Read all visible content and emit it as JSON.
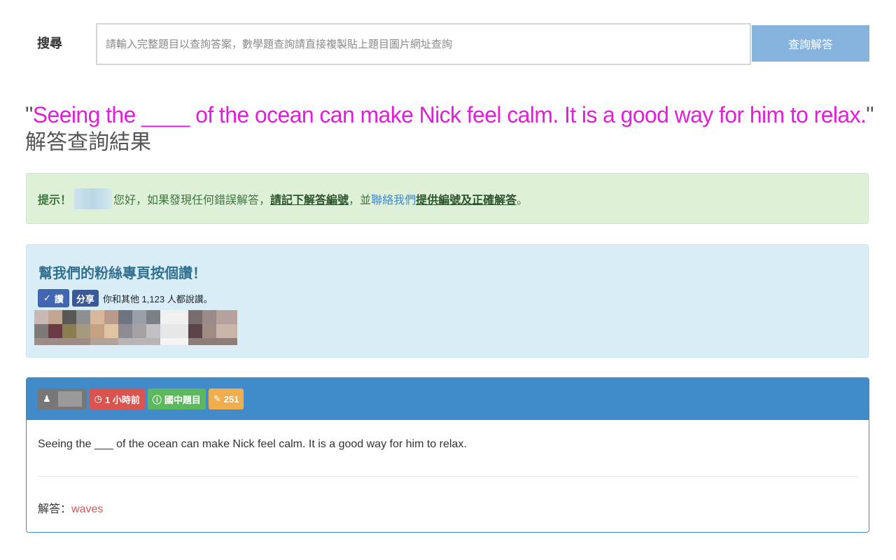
{
  "search": {
    "label": "搜尋",
    "placeholder": "請輸入完整題目以查詢答案，數學題查詢請直接複製貼上題目圖片網址查詢",
    "button_label": "查詢解答"
  },
  "title": {
    "open_quote": "\"",
    "question": "Seeing the ____ of the ocean can make Nick feel calm. It is a good way for him to relax.",
    "close_quote": "\"",
    "subtitle": "解答查詢結果"
  },
  "alert_success": {
    "prefix": "提示！",
    "text1": "您好，如果發現任何錯誤解答，",
    "bold_link1": "請記下解答編號",
    "text2": "，並",
    "link_contact": "聯絡我們",
    "bold_link2": "提供編號及正確解答",
    "text3": "。"
  },
  "alert_info": {
    "title": "幫我們的粉絲專頁按個讚！",
    "like_label": "讚",
    "share_label": "分享",
    "like_count_text": "你和其他 1,123 人都說讚。"
  },
  "question_panel": {
    "badges": {
      "time": "1 小時前",
      "category": "國中題目",
      "count": "251"
    },
    "question_text": "Seeing the ___ of the ocean can make Nick feel calm. It is a good way for him to relax.",
    "answer_label": "解答：",
    "answer_value": "waves"
  },
  "colors": {
    "title_question": "#e01fd8",
    "search_button": "#86b3dd",
    "panel_header": "#428bca",
    "badge_time": "#d9534f",
    "badge_category": "#5cb85c",
    "badge_count": "#f0ad4e",
    "answer_value": "#d9534f"
  },
  "icons": [
    "user-icon",
    "clock-icon",
    "info-icon",
    "edit-icon",
    "check-icon"
  ]
}
